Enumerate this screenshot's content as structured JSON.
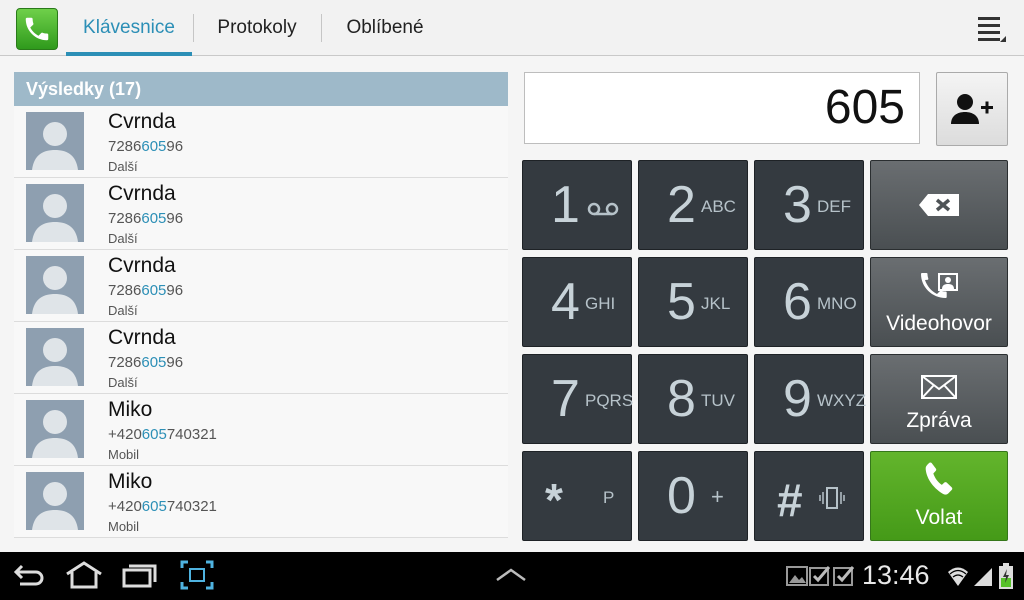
{
  "tabs": {
    "keypad": "Klávesnice",
    "log": "Protokoly",
    "favorites": "Oblíbené"
  },
  "results": {
    "header": "Výsledky (17)",
    "items": [
      {
        "name": "Cvrnda",
        "num_pre": "7286",
        "num_hl": "605",
        "num_post": "96",
        "type": "Další"
      },
      {
        "name": "Cvrnda",
        "num_pre": "7286",
        "num_hl": "605",
        "num_post": "96",
        "type": "Další"
      },
      {
        "name": "Cvrnda",
        "num_pre": "7286",
        "num_hl": "605",
        "num_post": "96",
        "type": "Další"
      },
      {
        "name": "Cvrnda",
        "num_pre": "7286",
        "num_hl": "605",
        "num_post": "96",
        "type": "Další"
      },
      {
        "name": "Miko",
        "num_pre": "+420",
        "num_hl": "605",
        "num_post": "740321",
        "type": "Mobil"
      },
      {
        "name": "Miko",
        "num_pre": "+420",
        "num_hl": "605",
        "num_post": "740321",
        "type": "Mobil"
      }
    ]
  },
  "dialer": {
    "number": "605",
    "keys": [
      {
        "digit": "1",
        "letters": ""
      },
      {
        "digit": "2",
        "letters": "ABC"
      },
      {
        "digit": "3",
        "letters": "DEF"
      },
      {
        "digit": "4",
        "letters": "GHI"
      },
      {
        "digit": "5",
        "letters": "JKL"
      },
      {
        "digit": "6",
        "letters": "MNO"
      },
      {
        "digit": "7",
        "letters": "PQRS"
      },
      {
        "digit": "8",
        "letters": "TUV"
      },
      {
        "digit": "9",
        "letters": "WXYZ"
      },
      {
        "digit": "*",
        "letters": "P"
      },
      {
        "digit": "0",
        "letters": "+"
      },
      {
        "digit": "#",
        "letters": ""
      }
    ],
    "actions": {
      "video": "Videohovor",
      "message": "Zpráva",
      "call": "Volat"
    }
  },
  "status": {
    "time": "13:46"
  },
  "colors": {
    "accent": "#2c8fb6",
    "call_green": "#4ea51f",
    "key_bg": "#343a40"
  },
  "icons": [
    "phone-icon",
    "menu-icon",
    "avatar-icon",
    "add-contact-icon",
    "voicemail-icon",
    "vibrate-icon",
    "backspace-icon",
    "video-call-icon",
    "message-icon",
    "call-icon",
    "back-icon",
    "home-icon",
    "recent-apps-icon",
    "screenshot-icon",
    "up-arrow-icon",
    "gallery-icon",
    "check-icon",
    "wifi-icon",
    "signal-icon",
    "battery-icon"
  ]
}
